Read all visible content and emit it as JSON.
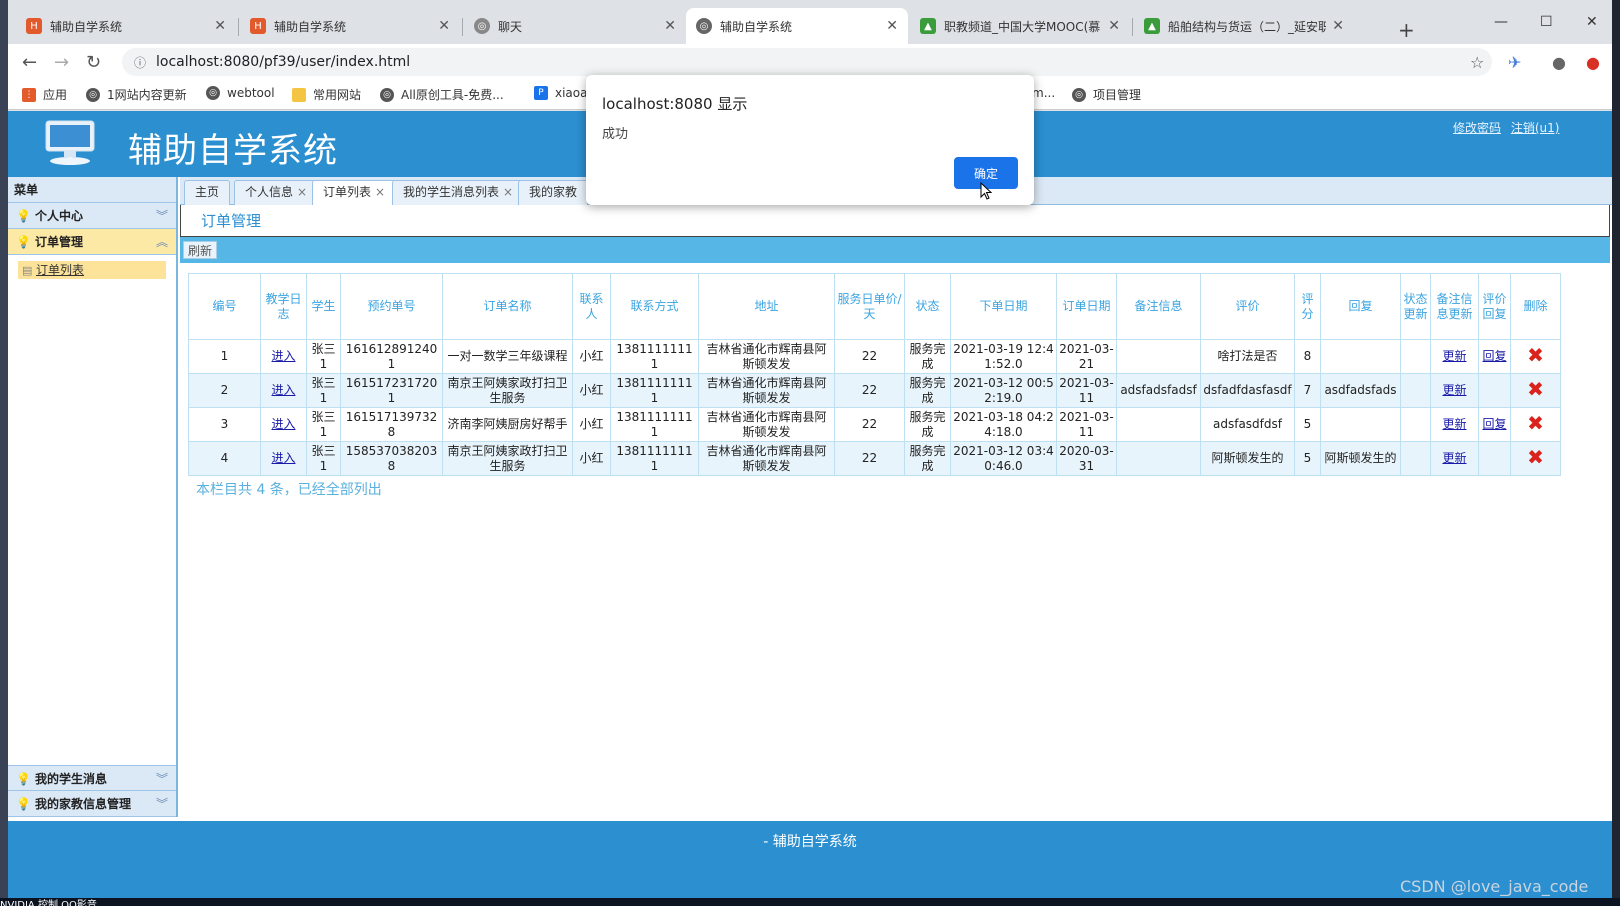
{
  "browser": {
    "tabs": [
      {
        "label": "辅助自学系统",
        "active": false
      },
      {
        "label": "辅助自学系统",
        "active": false
      },
      {
        "label": "聊天",
        "active": false
      },
      {
        "label": "辅助自学系统",
        "active": true
      },
      {
        "label": "职教频道_中国大学MOOC(慕",
        "active": false
      },
      {
        "label": "船舶结构与货运（二）_延安职",
        "active": false
      }
    ],
    "url": "localhost:8080/pf39/user/index.html",
    "bookmarks": [
      "应用",
      "1网站内容更新",
      "webtool",
      "常用网站",
      "All原创工具-免费...",
      "xiaoa",
      "m...",
      "项目管理"
    ]
  },
  "app": {
    "title": "辅助自学系统",
    "header_links": {
      "change_password": "修改密码",
      "logout": "注销(u1)"
    },
    "sidebar": {
      "heading": "菜单",
      "groups": [
        {
          "label": "个人中心",
          "open": false
        },
        {
          "label": "订单管理",
          "open": true,
          "items": [
            "订单列表"
          ]
        },
        {
          "label": "我的学生消息",
          "open": false
        },
        {
          "label": "我的家教信息管理",
          "open": false
        }
      ]
    },
    "page_tabs": [
      "主页",
      "个人信息",
      "订单列表",
      "我的学生消息列表",
      "我的家教"
    ],
    "panel_title": "订单管理",
    "refresh_label": "刷新",
    "table": {
      "headers": [
        "编号",
        "教学日志",
        "学生",
        "预约单号",
        "订单名称",
        "联系人",
        "联系方式",
        "地址",
        "服务日单价/天",
        "状态",
        "下单日期",
        "订单日期",
        "备注信息",
        "评价",
        "评分",
        "回复",
        "状态更新",
        "备注信息更新",
        "评价回复",
        "删除"
      ],
      "rows": [
        {
          "id": "1",
          "log": "进入",
          "student": "张三1",
          "booking": "1616128912401",
          "name": "一对一数学三年级课程",
          "contact": "小红",
          "phone": "13811111111",
          "address": "吉林省通化市辉南县阿斯顿发发",
          "price": "22",
          "status": "服务完成",
          "created": "2021-03-19 12:41:52.0",
          "order_date": "2021-03-21",
          "remark": "",
          "review": "啥打法是否",
          "score": "8",
          "reply": "",
          "status_update": "",
          "remark_update": "更新",
          "review_reply": "回复"
        },
        {
          "id": "2",
          "log": "进入",
          "student": "张三1",
          "booking": "1615172317201",
          "name": "南京王阿姨家政打扫卫生服务",
          "contact": "小红",
          "phone": "13811111111",
          "address": "吉林省通化市辉南县阿斯顿发发",
          "price": "22",
          "status": "服务完成",
          "created": "2021-03-12 00:52:19.0",
          "order_date": "2021-03-11",
          "remark": "adsfadsfadsf",
          "review": "dsfadfdasfasdf",
          "score": "7",
          "reply": "asdfadsfads",
          "status_update": "",
          "remark_update": "更新",
          "review_reply": ""
        },
        {
          "id": "3",
          "log": "进入",
          "student": "张三1",
          "booking": "1615171397328",
          "name": "济南李阿姨厨房好帮手",
          "contact": "小红",
          "phone": "13811111111",
          "address": "吉林省通化市辉南县阿斯顿发发",
          "price": "22",
          "status": "服务完成",
          "created": "2021-03-18 04:24:18.0",
          "order_date": "2021-03-11",
          "remark": "",
          "review": "adsfasdfdsf",
          "score": "5",
          "reply": "",
          "status_update": "",
          "remark_update": "更新",
          "review_reply": "回复"
        },
        {
          "id": "4",
          "log": "进入",
          "student": "张三1",
          "booking": "1585370382038",
          "name": "南京王阿姨家政打扫卫生服务",
          "contact": "小红",
          "phone": "13811111111",
          "address": "吉林省通化市辉南县阿斯顿发发",
          "price": "22",
          "status": "服务完成",
          "created": "2021-03-12 03:40:46.0",
          "order_date": "2020-03-31",
          "remark": "",
          "review": "阿斯顿发生的",
          "score": "5",
          "reply": "阿斯顿发生的",
          "status_update": "",
          "remark_update": "更新",
          "review_reply": ""
        }
      ]
    },
    "summary": "本栏目共 4 条，已经全部列出",
    "footer": "- 辅助自学系统"
  },
  "dialog": {
    "title": "localhost:8080 显示",
    "message": "成功",
    "ok": "确定"
  },
  "desktop": {
    "taskbar_text": "NVIDIA 控制 QQ影音",
    "watermark": "CSDN @love_java_code"
  },
  "colors": {
    "brand_blue": "#2b8fd0",
    "toolbar_blue": "#56b6e6",
    "delete_red": "#d9231c",
    "dialog_button": "#1a73e8"
  }
}
